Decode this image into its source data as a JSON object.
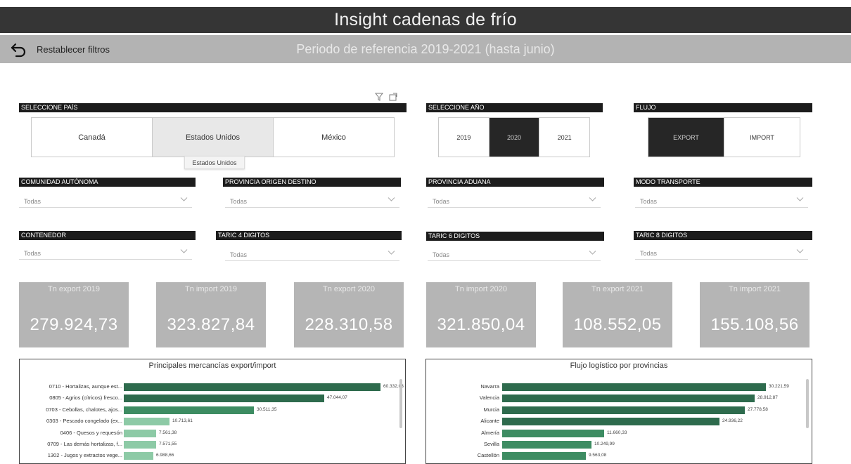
{
  "header": {
    "title": "Insight cadenas de frío",
    "period": "Periodo de referencia 2019-2021 (hasta junio)",
    "reset_label": "Restablecer filtros"
  },
  "country": {
    "header": "SELECCIONE PAÍS",
    "options": [
      "Canadá",
      "Estados Unidos",
      "México"
    ],
    "hovered": "Estados Unidos",
    "tooltip": "Estados Unidos"
  },
  "year": {
    "header": "SELECCIONE AÑO",
    "options": [
      "2019",
      "2020",
      "2021"
    ],
    "selected": "2020"
  },
  "flow": {
    "header": "FLUJO",
    "options": [
      "EXPORT",
      "IMPORT"
    ],
    "selected": "EXPORT"
  },
  "filters": [
    {
      "header": "COMUNIDAD AUTÓNOMA",
      "value": "Todas"
    },
    {
      "header": "PROVINCIA ORIGEN DESTINO",
      "value": "Todas"
    },
    {
      "header": "PROVINCIA ADUANA",
      "value": "Todas"
    },
    {
      "header": "MODO TRANSPORTE",
      "value": "Todas"
    },
    {
      "header": "CONTENEDOR",
      "value": "Todas"
    },
    {
      "header": "TARIC 4 DIGITOS",
      "value": "Todas"
    },
    {
      "header": "TARIC 6 DIGITOS",
      "value": "Todas"
    },
    {
      "header": "TARIC 8 DIGITOS",
      "value": "Todas"
    }
  ],
  "kpis": [
    {
      "label": "Tn export 2019",
      "value": "279.924,73"
    },
    {
      "label": "Tn import 2019",
      "value": "323.827,84"
    },
    {
      "label": "Tn export 2020",
      "value": "228.310,58"
    },
    {
      "label": "Tn import 2020",
      "value": "321.850,04"
    },
    {
      "label": "Tn export 2021",
      "value": "108.552,05"
    },
    {
      "label": "Tn import 2021",
      "value": "155.108,56"
    }
  ],
  "colors": {
    "dark_green": "#2e6b4d",
    "medium_green": "#3d8c62",
    "light_green": "#8dcaa6",
    "title_bar": "#353535",
    "sub_bar": "#b3b3b3",
    "kpi": "#b5b5b5"
  },
  "chart_data": [
    {
      "type": "bar",
      "orientation": "horizontal",
      "title": "Principales mercancías export/import",
      "categories": [
        "0710 - Hortalizas, aunque est...",
        "0805 - Agrios (cítricos) fresco...",
        "0703 - Cebollas, chalotes, ajos...",
        "0303 - Pescado congelado (ex...",
        "0406 - Quesos y requesón",
        "0709 - Las demás hortalizas, f...",
        "1302 - Jugos y extractos vege..."
      ],
      "values": [
        60332.03,
        47044.07,
        30511.35,
        10713.61,
        7561.38,
        7571.55,
        6988.66
      ],
      "value_labels": [
        "60.332,03",
        "47.044,07",
        "30.511,35",
        "10.713,61",
        "7.561,38",
        "7.571,55",
        "6.988,66"
      ],
      "bar_colors": [
        "#2e6b4d",
        "#2e6b4d",
        "#3d8c62",
        "#8dcaa6",
        "#8dcaa6",
        "#8dcaa6",
        "#8dcaa6"
      ],
      "xlim": [
        0,
        60332.03
      ]
    },
    {
      "type": "bar",
      "orientation": "horizontal",
      "title": "Flujo logístico por provincias",
      "categories": [
        "Navarra",
        "Valencia",
        "Murcia",
        "Alicante",
        "Almería",
        "Sevilla",
        "Castellón"
      ],
      "values": [
        30221.59,
        28912.87,
        27778.58,
        24936.22,
        11660.33,
        10249.99,
        9563.08
      ],
      "value_labels": [
        "30.221,59",
        "28.912,87",
        "27.778,58",
        "24.936,22",
        "11.660,33",
        "10.249,99",
        "9.563,08"
      ],
      "bar_colors": [
        "#2e6b4d",
        "#2e6b4d",
        "#2e6b4d",
        "#2e6b4d",
        "#3d8c62",
        "#3d8c62",
        "#3d8c62"
      ],
      "xlim": [
        0,
        30221.59
      ]
    }
  ]
}
